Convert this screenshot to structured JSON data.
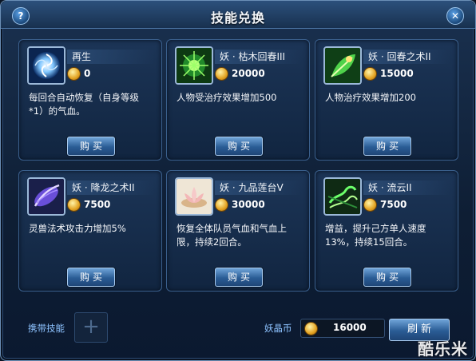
{
  "window": {
    "title": "技能兑换",
    "help_label": "?",
    "close_label": "✕"
  },
  "skills": [
    {
      "name": "再生",
      "price": "0",
      "desc": "每回合自动恢复（自身等级*1）的气血。",
      "buy_label": "购买",
      "icon": "swirl-orb-icon"
    },
    {
      "name": "妖 · 枯木回春III",
      "price": "20000",
      "desc": "人物受治疗效果增加500",
      "buy_label": "购买",
      "icon": "green-sparkle-icon"
    },
    {
      "name": "妖 · 回春之术II",
      "price": "15000",
      "desc": "人物治疗效果增加200",
      "buy_label": "购买",
      "icon": "green-leaf-icon"
    },
    {
      "name": "妖 · 降龙之术II",
      "price": "7500",
      "desc": "灵兽法术攻击力增加5%",
      "buy_label": "购买",
      "icon": "purple-claw-icon"
    },
    {
      "name": "妖 · 九品莲台V",
      "price": "30000",
      "desc": "恢复全体队员气血和气血上限，持续2回合。",
      "buy_label": "购买",
      "icon": "lotus-icon"
    },
    {
      "name": "妖 · 流云II",
      "price": "7500",
      "desc": "增益，提升己方单人速度13%，持续15回合。",
      "buy_label": "购买",
      "icon": "green-cloud-icon"
    }
  ],
  "footer": {
    "carry_label": "携带技能",
    "carry_slot_glyph": "+",
    "currency_label": "妖晶币",
    "currency_value": "16000",
    "refresh_label": "刷新"
  },
  "watermark": "酷乐米",
  "colors": {
    "accent": "#8ec3ff",
    "button": "#2a5c95",
    "coin": "#e3a322"
  }
}
